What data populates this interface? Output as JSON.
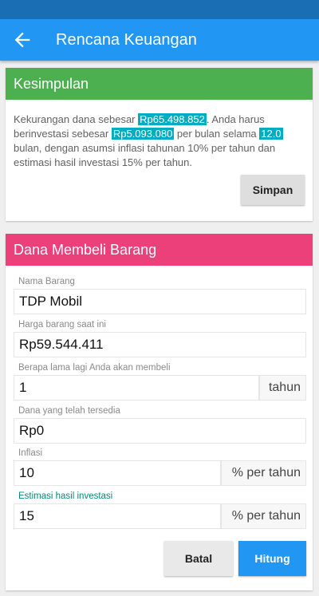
{
  "app_bar": {
    "title": "Rencana Keuangan"
  },
  "summary": {
    "header": "Kesimpulan",
    "text_1": "Kekurangan dana sebesar ",
    "shortfall": "Rp65.498.852",
    "text_2": ". Anda harus berinvestasi sebesar ",
    "monthly_investment": "Rp5.093.080",
    "text_3": " per bulan selama ",
    "months": "12.0",
    "text_4": " bulan, dengan asumsi inflasi tahunan 10% per tahun dan estimasi hasil investasi 15% per tahun.",
    "save_button": "Simpan"
  },
  "form": {
    "header": "Dana Membeli Barang",
    "fields": {
      "item_name": {
        "label": "Nama Barang",
        "value": "TDP Mobil"
      },
      "price": {
        "label": "Harga barang saat ini",
        "value": "Rp59.544.411"
      },
      "years": {
        "label": "Berapa lama lagi Anda akan membeli",
        "value": "1",
        "unit": "tahun"
      },
      "funds": {
        "label": "Dana yang telah tersedia",
        "value": "Rp0"
      },
      "inflation": {
        "label": "Inflasi",
        "value": "10",
        "unit": "% per tahun"
      },
      "return": {
        "label": "Estimasi hasil investasi",
        "value": "15",
        "unit": "% per tahun"
      }
    },
    "cancel_button": "Batal",
    "calculate_button": "Hitung"
  },
  "colors": {
    "app_bar": "#2196f3",
    "status_bar": "#1a6fb4",
    "summary_header": "#4caf50",
    "form_header": "#ec407a",
    "highlight": "#00acc1"
  }
}
